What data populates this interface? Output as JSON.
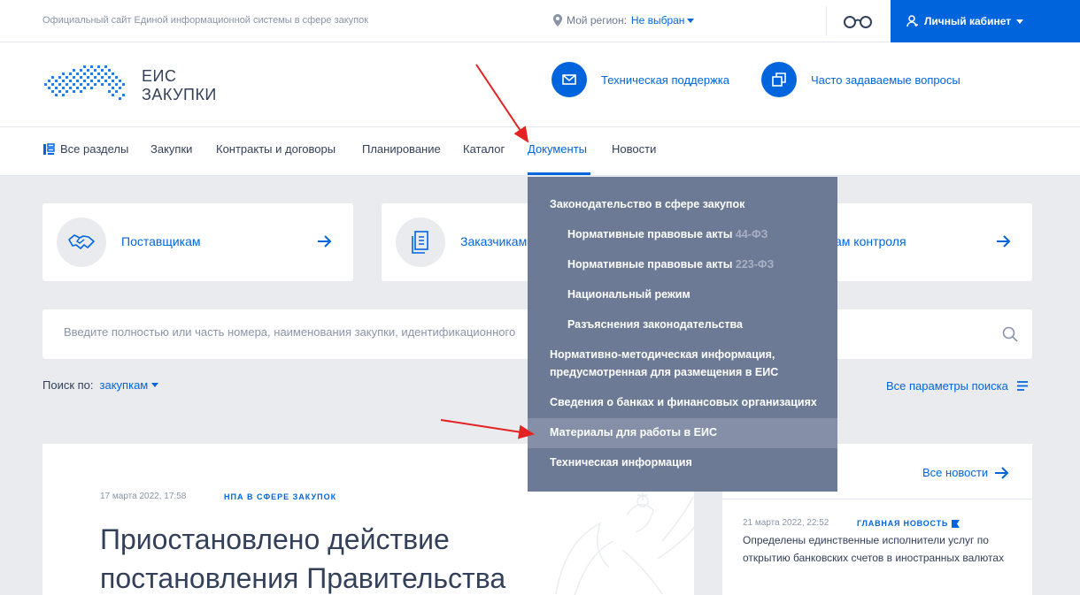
{
  "topbar": {
    "site_description": "Официальный сайт Единой информационной системы в сфере закупок",
    "region_label": "Мой регион:",
    "region_value": "Не выбран",
    "cabinet_label": "Личный кабинет"
  },
  "header": {
    "logo_line1": "ЕИС",
    "logo_line2": "ЗАКУПКИ",
    "support_label": "Техническая поддержка",
    "faq_label": "Часто задаваемые вопросы"
  },
  "nav": {
    "items": [
      {
        "label": "Все разделы"
      },
      {
        "label": "Закупки"
      },
      {
        "label": "Контракты и договоры"
      },
      {
        "label": "Планирование"
      },
      {
        "label": "Каталог"
      },
      {
        "label": "Документы"
      },
      {
        "label": "Новости"
      }
    ]
  },
  "cards": [
    {
      "label": "Поставщикам"
    },
    {
      "label": "Заказчикам"
    },
    {
      "label": "ам контроля"
    }
  ],
  "search": {
    "placeholder": "Введите полностью или часть номера, наименования закупки, идентификационного",
    "by_label": "Поиск по:",
    "by_value": "закупкам",
    "all_params": "Все параметры поиска"
  },
  "news_main": {
    "date": "17 марта 2022, 17:58",
    "tag": "НПА В СФЕРЕ ЗАКУПОК",
    "title": "Приостановлено действие постановления Правительства"
  },
  "news_side": {
    "all_news": "Все новости",
    "date": "21 марта 2022, 22:52",
    "tag": "ГЛАВНАЯ НОВОСТЬ",
    "title": "Определены единственные исполнители услуг по открытию банковских счетов в иностранных валютах"
  },
  "dropdown": {
    "items": [
      {
        "label": "Законодательство в сфере закупок"
      },
      {
        "label": "Нормативные правовые акты",
        "law": "44-ФЗ"
      },
      {
        "label": "Нормативные правовые акты",
        "law": "223-ФЗ"
      },
      {
        "label": "Национальный режим"
      },
      {
        "label": "Разъяснения законодательства"
      },
      {
        "label": "Нормативно-методическая информация, предусмотренная для размещения в ЕИС"
      },
      {
        "label": "Сведения о банках и финансовых организациях"
      },
      {
        "label": "Материалы для работы в ЕИС"
      },
      {
        "label": "Техническая информация"
      }
    ],
    "highlighted_index": 7
  },
  "colors": {
    "accent": "#0065dd",
    "dropdown_bg": "#6c7a96",
    "dropdown_highlight": "#8590a8",
    "annotation": "#e52222"
  }
}
